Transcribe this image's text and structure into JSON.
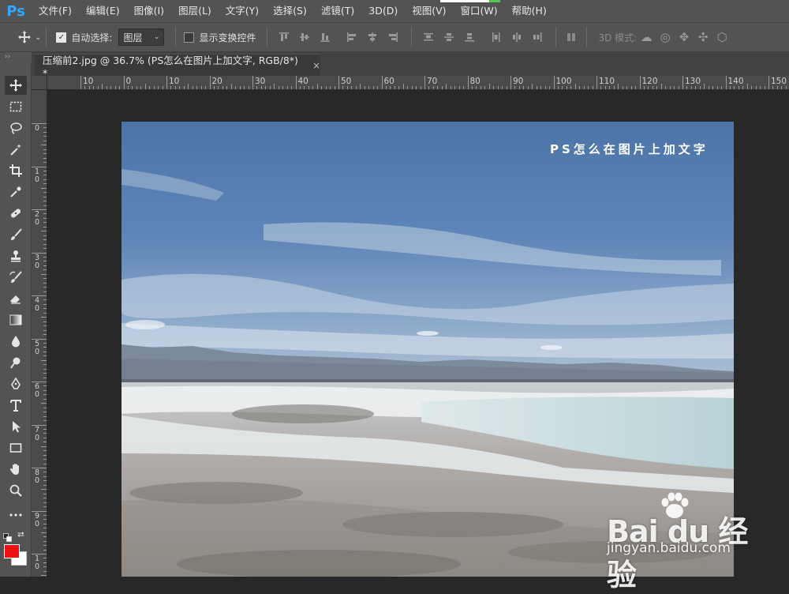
{
  "app": {
    "logo": "Ps"
  },
  "menu": {
    "items": [
      "文件(F)",
      "编辑(E)",
      "图像(I)",
      "图层(L)",
      "文字(Y)",
      "选择(S)",
      "滤镜(T)",
      "3D(D)",
      "视图(V)",
      "窗口(W)",
      "帮助(H)"
    ]
  },
  "options": {
    "auto_select_label": "自动选择:",
    "auto_select_checked": true,
    "auto_select_target": "图层",
    "show_transform_label": "显示变换控件",
    "show_transform_checked": false,
    "mode_label": "3D 模式:"
  },
  "panel_collapse": "››",
  "document": {
    "tab_title": "压缩前2.jpg @ 36.7% (PS怎么在图片上加文字, RGB/8*) *",
    "close_glyph": "×",
    "overlay_text": "PS怎么在图片上加文字"
  },
  "rulers": {
    "horizontal": [
      "10",
      "0",
      "10",
      "20",
      "30",
      "40",
      "50",
      "60",
      "70",
      "80",
      "90",
      "100",
      "110",
      "120",
      "130",
      "140",
      "150"
    ],
    "vertical": [
      "0",
      "10",
      "20",
      "30",
      "40",
      "50",
      "60",
      "70",
      "80",
      "90",
      "10"
    ]
  },
  "colors": {
    "foreground": "#ee1111",
    "background": "#ffffff",
    "accent": "#31a8ff"
  },
  "tools": [
    "move-tool",
    "marquee-tool",
    "lasso-tool",
    "magic-wand-tool",
    "crop-tool",
    "eyedropper-tool",
    "healing-brush-tool",
    "brush-tool",
    "clone-stamp-tool",
    "history-brush-tool",
    "eraser-tool",
    "gradient-tool",
    "blur-tool",
    "dodge-tool",
    "pen-tool",
    "type-tool",
    "path-selection-tool",
    "rectangle-tool",
    "hand-tool",
    "zoom-tool",
    "more-tools"
  ],
  "watermark": {
    "logo": "Bai du 经验",
    "url": "jingyan.baidu.com"
  }
}
